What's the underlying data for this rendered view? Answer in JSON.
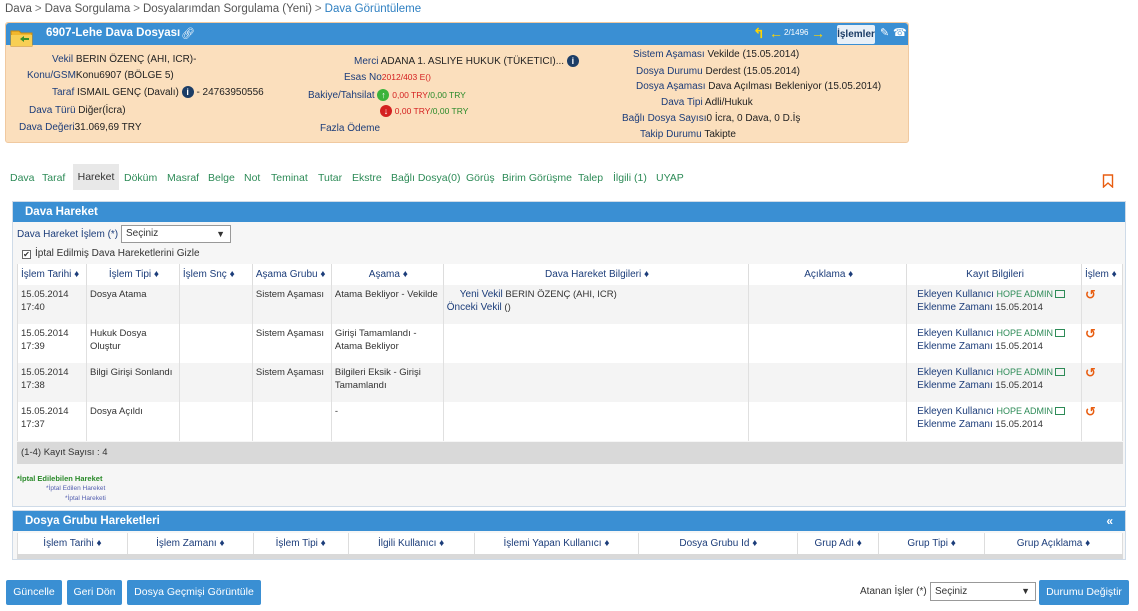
{
  "breadcrumb": [
    "Dava",
    "Dava Sorgulama",
    "Dosyalarımdan Sorgulama (Yeni)",
    "Dava Görüntüleme"
  ],
  "header": {
    "title": "6907-Lehe Dava Dosyası",
    "nav_count": "2/1496",
    "islemler": "İşlemler"
  },
  "details": {
    "vekil_label": "Vekil",
    "vekil_value": "BERIN ÖZENÇ (AHI, ICR)-",
    "konu_label": "Konu/GSM",
    "konu_value": "Konu6907 (BÖLGE 5)",
    "taraf_label": "Taraf",
    "taraf_value": "ISMAIL GENÇ (Davalı)",
    "taraf_phone": "- 24763950556",
    "turu_label": "Dava Türü",
    "turu_value": "Diğer(İcra)",
    "degeri_label": "Dava Değeri",
    "degeri_value": "31.069,69 TRY",
    "merci_label": "Merci",
    "merci_value": "ADANA 1. ASLIYE HUKUK (TÜKETICI)...",
    "esas_label": "Esas No",
    "esas_value": "2012/403 E()",
    "bakiye_label": "Bakiye/Tahsilat",
    "bakiye_1_red": "0,00 TRY",
    "bakiye_1_green": "0,00 TRY",
    "bakiye_2_red": "0,00 TRY",
    "bakiye_2_green": "0,00 TRY",
    "fazla_label": "Fazla Ödeme",
    "sistem_label": "Sistem Aşaması",
    "sistem_value": "Vekilde (15.05.2014)",
    "durumu_label": "Dosya Durumu",
    "durumu_value": "Derdest (15.05.2014)",
    "dasama_label": "Dosya Aşaması",
    "dasama_value": "Dava Açılması Bekleniyor (15.05.2014)",
    "tipi_label": "Dava Tipi",
    "tipi_value": "Adli/Hukuk",
    "bagli_label": "Bağlı Dosya Sayısı",
    "bagli_value": "0 İcra, 0 Dava, 0 D.İş",
    "takip_label": "Takip Durumu",
    "takip_value": "Takipte"
  },
  "tabs": [
    "Dava",
    "Taraf",
    "Hareket",
    "Döküm",
    "Masraf",
    "Belge",
    "Not",
    "Teminat",
    "Tutar",
    "Ekstre",
    "Bağlı Dosya(0)",
    "Görüş",
    "Birim Görüşme",
    "Talep",
    "İlgili (1)",
    "UYAP"
  ],
  "hareket": {
    "title": "Dava Hareket",
    "islem_label": "Dava Hareket İşlem (*)",
    "islem_select": "Seçiniz",
    "hide_label": "İptal Edilmiş Dava Hareketlerini Gizle",
    "columns": [
      "İşlem Tarihi ♦",
      "İşlem Tipi ♦",
      "İşlem Snç ♦",
      "Aşama Grubu ♦",
      "Aşama ♦",
      "Dava Hareket Bilgileri ♦",
      "Açıklama ♦",
      "Kayıt Bilgileri",
      "İşlem ♦"
    ],
    "rows": [
      {
        "date": "15.05.2014",
        "time": "17:40",
        "tip": "Dosya Atama",
        "snc": "",
        "grup": "Sistem Aşaması",
        "asama": "Atama Bekliyor - Vekilde",
        "info_l1": "Yeni Vekil",
        "info_v1": "BERIN ÖZENÇ (AHI, ICR)",
        "info_l2": "Önceki Vekil",
        "info_v2": "()",
        "aciklama": "",
        "ekleyen_label": "Ekleyen Kullanıcı",
        "ekleyen": "HOPE ADMIN",
        "zaman_label": "Eklenme Zamanı",
        "zaman": "15.05.2014"
      },
      {
        "date": "15.05.2014",
        "time": "17:39",
        "tip": "Hukuk Dosya Oluştur",
        "snc": "",
        "grup": "Sistem Aşaması",
        "asama": "Girişi Tamamlandı - Atama Bekliyor",
        "info_l1": "",
        "info_v1": "",
        "info_l2": "",
        "info_v2": "",
        "aciklama": "",
        "ekleyen_label": "Ekleyen Kullanıcı",
        "ekleyen": "HOPE ADMIN",
        "zaman_label": "Eklenme Zamanı",
        "zaman": "15.05.2014"
      },
      {
        "date": "15.05.2014",
        "time": "17:38",
        "tip": "Bilgi Girişi Sonlandı",
        "snc": "",
        "grup": "Sistem Aşaması",
        "asama": "Bilgileri Eksik - Girişi Tamamlandı",
        "info_l1": "",
        "info_v1": "",
        "info_l2": "",
        "info_v2": "",
        "aciklama": "",
        "ekleyen_label": "Ekleyen Kullanıcı",
        "ekleyen": "HOPE ADMIN",
        "zaman_label": "Eklenme Zamanı",
        "zaman": "15.05.2014"
      },
      {
        "date": "15.05.2014",
        "time": "17:37",
        "tip": "Dosya Açıldı",
        "snc": "",
        "grup": "",
        "asama": "-",
        "info_l1": "",
        "info_v1": "",
        "info_l2": "",
        "info_v2": "",
        "aciklama": "",
        "ekleyen_label": "Ekleyen Kullanıcı",
        "ekleyen": "HOPE ADMIN",
        "zaman_label": "Eklenme Zamanı",
        "zaman": "15.05.2014"
      }
    ],
    "count": "(1-4) Kayıt Sayısı : 4",
    "legend": [
      "*İptal Edilebilen Hareket",
      "*İptal Edilen Hareket",
      "*İptal Hareketi"
    ]
  },
  "grup": {
    "title": "Dosya Grubu Hareketleri",
    "collapse": "«",
    "columns": [
      "İşlem Tarihi ♦",
      "İşlem Zamanı ♦",
      "İşlem Tipi ♦",
      "İlgili Kullanıcı ♦",
      "İşlemi Yapan Kullanıcı ♦",
      "Dosya Grubu Id ♦",
      "Grup Adı ♦",
      "Grup Tipi ♦",
      "Grup Açıklama ♦"
    ]
  },
  "footer": {
    "guncelle": "Güncelle",
    "geri_don": "Geri Dön",
    "gecmis": "Dosya Geçmişi Görüntüle",
    "atanan_label": "Atanan İşler (*)",
    "atanan_select": "Seçiniz",
    "durumu_degistir": "Durumu Değiştir"
  },
  "colors": {
    "primary": "#3a8fd3",
    "panel": "#fbdfbd",
    "tab_text": "#2d8b57",
    "label": "#1c3d7a",
    "accent_red": "#d42020",
    "accent_green": "#2a8a2a",
    "restore": "#e85d10"
  }
}
